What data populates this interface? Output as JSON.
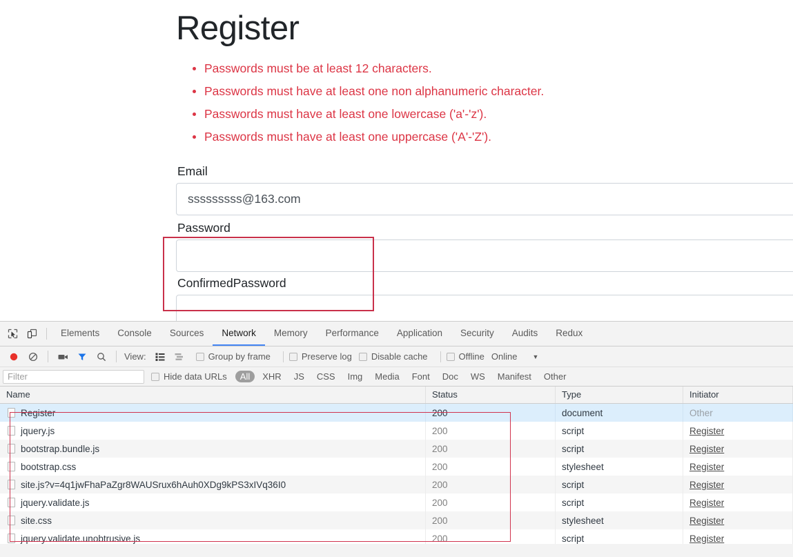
{
  "page": {
    "title": "Register",
    "validation_errors": [
      "Passwords must be at least 12 characters.",
      "Passwords must have at least one non alphanumeric character.",
      "Passwords must have at least one lowercase ('a'-'z').",
      "Passwords must have at least one uppercase ('A'-'Z')."
    ],
    "error_color": "#dc3545",
    "fields": [
      {
        "label": "Email",
        "value": "sssssssss@163.com",
        "placeholder": "",
        "type": "text"
      },
      {
        "label": "Password",
        "value": "",
        "placeholder": "",
        "type": "password"
      },
      {
        "label": "ConfirmedPassword",
        "value": "",
        "placeholder": "",
        "type": "password"
      }
    ]
  },
  "devtools": {
    "tabs": [
      {
        "label": "Elements",
        "active": false
      },
      {
        "label": "Console",
        "active": false
      },
      {
        "label": "Sources",
        "active": false
      },
      {
        "label": "Network",
        "active": true
      },
      {
        "label": "Memory",
        "active": false
      },
      {
        "label": "Performance",
        "active": false
      },
      {
        "label": "Application",
        "active": false
      },
      {
        "label": "Security",
        "active": false
      },
      {
        "label": "Audits",
        "active": false
      },
      {
        "label": "Redux",
        "active": false
      }
    ],
    "active_tab_underline_color": "#4285f4",
    "icons": {
      "inspect": "inspect-element-icon",
      "device": "device-toolbar-icon",
      "record": "record-icon",
      "clear": "clear-icon",
      "camera": "screenshot-camera-icon",
      "filter": "filter-funnel-icon",
      "search": "search-icon",
      "view_list": "view-list-icon",
      "view_waterfall": "view-waterfall-icon"
    },
    "controls": {
      "view_label": "View:",
      "group_by_frame": "Group by frame",
      "preserve_log": "Preserve log",
      "disable_cache": "Disable cache",
      "offline": "Offline",
      "throttling": "Online",
      "caret": "▼"
    },
    "filter": {
      "placeholder": "Filter",
      "value": "",
      "hide_data_urls": "Hide data URLs",
      "types": [
        {
          "label": "All",
          "active": true
        },
        {
          "label": "XHR",
          "active": false
        },
        {
          "label": "JS",
          "active": false
        },
        {
          "label": "CSS",
          "active": false
        },
        {
          "label": "Img",
          "active": false
        },
        {
          "label": "Media",
          "active": false
        },
        {
          "label": "Font",
          "active": false
        },
        {
          "label": "Doc",
          "active": false
        },
        {
          "label": "WS",
          "active": false
        },
        {
          "label": "Manifest",
          "active": false
        },
        {
          "label": "Other",
          "active": false
        }
      ]
    },
    "table": {
      "columns": [
        "Name",
        "Status",
        "Type",
        "Initiator"
      ],
      "rows": [
        {
          "name": "Register",
          "status": "200",
          "type": "document",
          "initiator": "Other",
          "selected": true,
          "initiator_is_link": false
        },
        {
          "name": "jquery.js",
          "status": "200",
          "type": "script",
          "initiator": "Register",
          "selected": false,
          "initiator_is_link": true
        },
        {
          "name": "bootstrap.bundle.js",
          "status": "200",
          "type": "script",
          "initiator": "Register",
          "selected": false,
          "initiator_is_link": true
        },
        {
          "name": "bootstrap.css",
          "status": "200",
          "type": "stylesheet",
          "initiator": "Register",
          "selected": false,
          "initiator_is_link": true
        },
        {
          "name": "site.js?v=4q1jwFhaPaZgr8WAUSrux6hAuh0XDg9kPS3xIVq36I0",
          "status": "200",
          "type": "script",
          "initiator": "Register",
          "selected": false,
          "initiator_is_link": true
        },
        {
          "name": "jquery.validate.js",
          "status": "200",
          "type": "script",
          "initiator": "Register",
          "selected": false,
          "initiator_is_link": true
        },
        {
          "name": "site.css",
          "status": "200",
          "type": "stylesheet",
          "initiator": "Register",
          "selected": false,
          "initiator_is_link": true
        },
        {
          "name": "jquery.validate.unobtrusive.js",
          "status": "200",
          "type": "script",
          "initiator": "Register",
          "selected": false,
          "initiator_is_link": true
        }
      ]
    }
  },
  "annotations": {
    "color": "#d0334e",
    "form_highlight": "password-fields-highlight",
    "table_highlight": "network-requests-highlight"
  }
}
